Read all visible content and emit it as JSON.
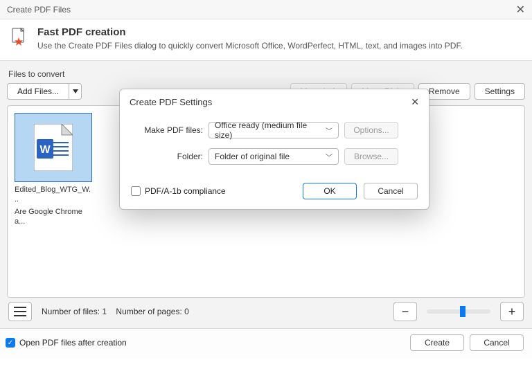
{
  "window": {
    "title": "Create PDF Files"
  },
  "header": {
    "title": "Fast PDF creation",
    "subtitle": "Use the Create PDF Files dialog to quickly convert Microsoft Office, WordPerfect, HTML, text, and images into PDF."
  },
  "section_label": "Files to convert",
  "buttons": {
    "add_files": "Add Files...",
    "move_left": "Move Left",
    "move_right": "Move Right",
    "remove": "Remove",
    "settings": "Settings"
  },
  "file": {
    "line1": "Edited_Blog_WTG_W...",
    "line2": "Are Google Chrome a..."
  },
  "counts": {
    "files_label": "Number of files:",
    "files_value": "1",
    "pages_label": "Number of pages:",
    "pages_value": "0"
  },
  "footer": {
    "open_after": "Open PDF files after creation",
    "create": "Create",
    "cancel": "Cancel"
  },
  "modal": {
    "title": "Create PDF Settings",
    "make_label": "Make PDF files:",
    "make_value": "Office ready (medium file size)",
    "options": "Options...",
    "folder_label": "Folder:",
    "folder_value": "Folder of original file",
    "browse": "Browse...",
    "pdfa": "PDF/A-1b compliance",
    "ok": "OK",
    "cancel": "Cancel"
  }
}
